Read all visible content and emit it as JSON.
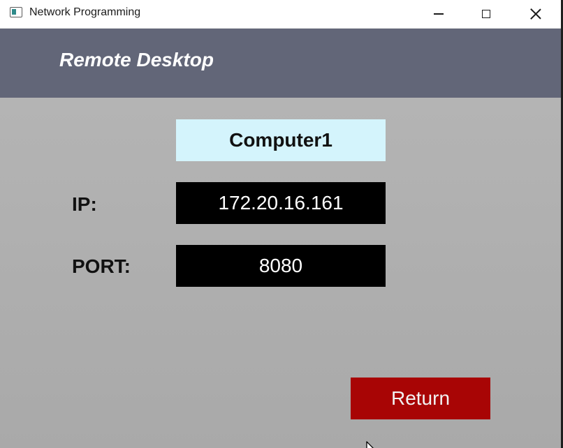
{
  "window": {
    "title": "Network Programming",
    "controls": [
      "minimize",
      "maximize",
      "close"
    ]
  },
  "header": {
    "title": "Remote Desktop",
    "background_color": "#626678"
  },
  "computer": {
    "name": "Computer1",
    "name_background_color": "#d4f4fc"
  },
  "fields": {
    "ip": {
      "label": "IP:",
      "value": "172.20.16.161"
    },
    "port": {
      "label": "PORT:",
      "value": "8080"
    }
  },
  "actions": {
    "return_label": "Return",
    "return_color": "#a80505"
  },
  "icons": {
    "app": "app-window-icon",
    "minimize": "minimize-icon",
    "maximize": "maximize-icon",
    "close": "close-icon",
    "cursor": "mouse-pointer-icon"
  }
}
